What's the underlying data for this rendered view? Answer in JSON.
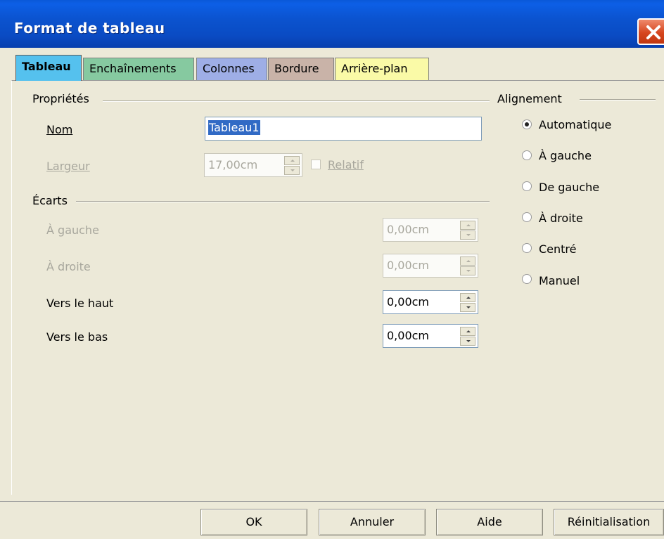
{
  "window": {
    "title": "Format de tableau"
  },
  "tabs": [
    {
      "label": "Tableau",
      "color": "#55c1ee"
    },
    {
      "label": "Enchaînements",
      "color": "#86c9a0"
    },
    {
      "label": "Colonnes",
      "color": "#9eaee6"
    },
    {
      "label": "Bordure",
      "color": "#c9b3a8"
    },
    {
      "label": "Arrière-plan",
      "color": "#fafaa7"
    }
  ],
  "properties": {
    "section_label": "Propriétés",
    "name_label": "Nom",
    "name_value": "Tableau1",
    "width_label": "Largeur",
    "width_value": "17,00cm",
    "relative_label": "Relatif"
  },
  "spacing": {
    "section_label": "Écarts",
    "rows": [
      {
        "label": "À gauche",
        "value": "0,00cm"
      },
      {
        "label": "À droite",
        "value": "0,00cm"
      },
      {
        "label": "Vers le haut",
        "value": "0,00cm"
      },
      {
        "label": "Vers le bas",
        "value": "0,00cm"
      }
    ]
  },
  "alignment": {
    "section_label": "Alignement",
    "options": [
      "Automatique",
      "À gauche",
      "De gauche",
      "À droite",
      "Centré",
      "Manuel"
    ],
    "selected": "Automatique"
  },
  "buttons": {
    "ok": "OK",
    "cancel": "Annuler",
    "help": "Aide",
    "reset": "Réinitialisation"
  }
}
